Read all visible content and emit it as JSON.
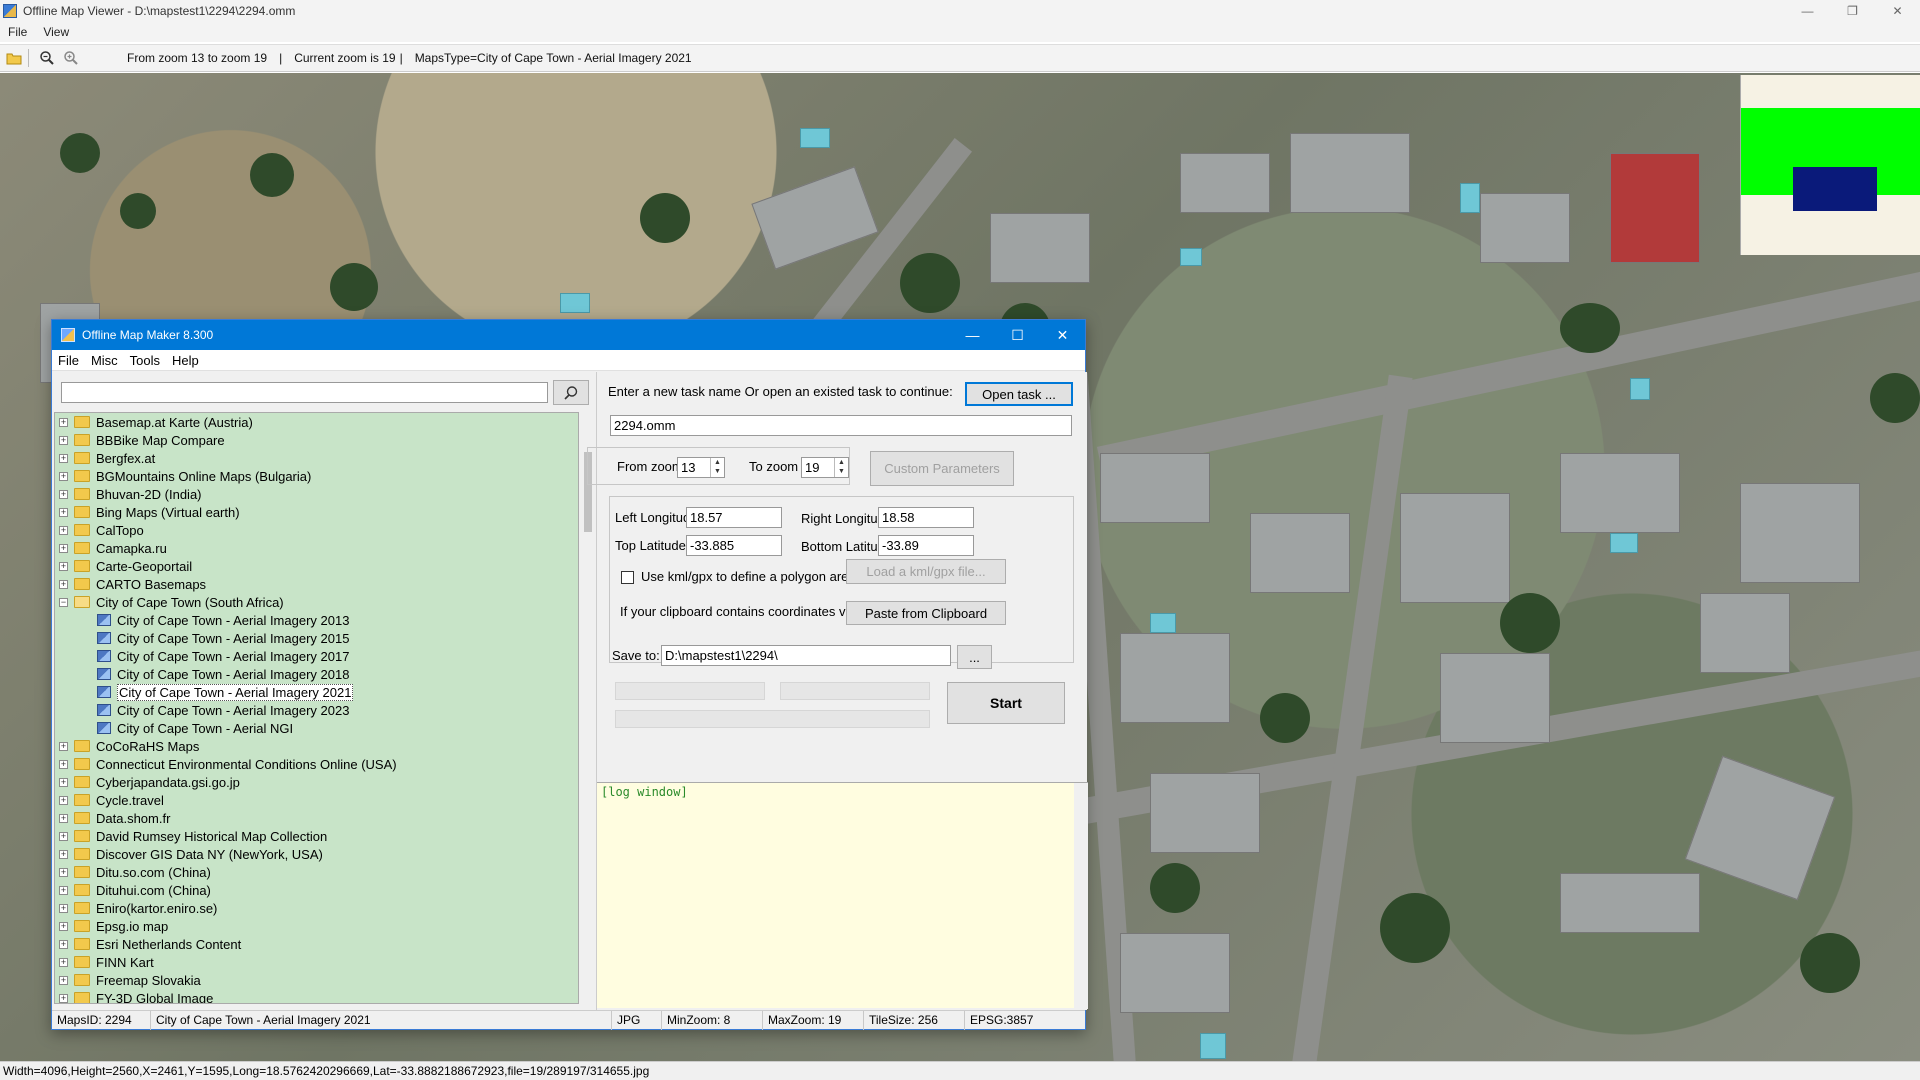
{
  "viewer": {
    "title": "Offline Map Viewer - D:\\mapstest1\\2294\\2294.omm",
    "menu": [
      "File",
      "View"
    ],
    "toolbar": {
      "zoom_range": "From zoom 13 to zoom 19",
      "current_zoom": "Current zoom is 19",
      "maps_type": "MapsType=City of Cape Town - Aerial Imagery 2021",
      "sep": "|"
    },
    "window_controls": {
      "minimize": "—",
      "restore": "❐",
      "close": "✕"
    },
    "statusbar": "Width=4096,Height=2560,X=2461,Y=1595,Long=18.5762420296669,Lat=-33.8882188672923,file=19/289197/314655.jpg"
  },
  "dialog": {
    "title": "Offline Map Maker 8.300",
    "window_controls": {
      "minimize": "—",
      "maximize": "☐",
      "close": "✕"
    },
    "menu": [
      "File",
      "Misc",
      "Tools",
      "Help"
    ],
    "search": {
      "value": "",
      "placeholder": ""
    },
    "tree": [
      {
        "label": "Basemap.at Karte (Austria)",
        "expanded": false
      },
      {
        "label": "BBBike Map Compare",
        "expanded": false
      },
      {
        "label": "Bergfex.at",
        "expanded": false
      },
      {
        "label": "BGMountains Online Maps (Bulgaria)",
        "expanded": false
      },
      {
        "label": "Bhuvan-2D (India)",
        "expanded": false
      },
      {
        "label": "Bing Maps (Virtual earth)",
        "expanded": false
      },
      {
        "label": "CalTopo",
        "expanded": false
      },
      {
        "label": "Camapka.ru",
        "expanded": false
      },
      {
        "label": "Carte-Geoportail",
        "expanded": false
      },
      {
        "label": "CARTO Basemaps",
        "expanded": false
      },
      {
        "label": "City of Cape Town (South Africa)",
        "expanded": true,
        "children": [
          {
            "label": "City of Cape Town - Aerial Imagery 2013",
            "selected": false
          },
          {
            "label": "City of Cape Town - Aerial Imagery 2015",
            "selected": false
          },
          {
            "label": "City of Cape Town - Aerial Imagery 2017",
            "selected": false
          },
          {
            "label": "City of Cape Town - Aerial Imagery 2018",
            "selected": false
          },
          {
            "label": "City of Cape Town - Aerial Imagery 2021",
            "selected": true
          },
          {
            "label": "City of Cape Town - Aerial Imagery 2023",
            "selected": false
          },
          {
            "label": "City of Cape Town - Aerial NGI",
            "selected": false
          }
        ]
      },
      {
        "label": "CoCoRaHS Maps",
        "expanded": false
      },
      {
        "label": "Connecticut Environmental Conditions Online (USA)",
        "expanded": false
      },
      {
        "label": "Cyberjapandata.gsi.go.jp",
        "expanded": false
      },
      {
        "label": "Cycle.travel",
        "expanded": false
      },
      {
        "label": "Data.shom.fr",
        "expanded": false
      },
      {
        "label": "David Rumsey Historical Map Collection",
        "expanded": false
      },
      {
        "label": "Discover GIS Data NY (NewYork, USA)",
        "expanded": false
      },
      {
        "label": "Ditu.so.com (China)",
        "expanded": false
      },
      {
        "label": "Dituhui.com (China)",
        "expanded": false
      },
      {
        "label": "Eniro(kartor.eniro.se)",
        "expanded": false
      },
      {
        "label": "Epsg.io map",
        "expanded": false
      },
      {
        "label": "Esri Netherlands Content",
        "expanded": false
      },
      {
        "label": "FINN Kart",
        "expanded": false
      },
      {
        "label": "Freemap Slovakia",
        "expanded": false
      },
      {
        "label": "FY-3D Global Image",
        "expanded": false
      }
    ],
    "task": {
      "prompt": "Enter a new task name Or open an existed task to continue:",
      "open_button": "Open task ...",
      "task_name": "2294.omm"
    },
    "zoom": {
      "from_label": "From zoom",
      "from_value": "13",
      "to_label": "To zoom",
      "to_value": "19",
      "custom_button": "Custom Parameters"
    },
    "coords": {
      "left_lon_label": "Left Longitude",
      "left_lon": "18.57",
      "right_lon_label": "Right Longitude",
      "right_lon": "18.58",
      "top_lat_label": "Top Latitude",
      "top_lat": "-33.885",
      "bottom_lat_label": "Bottom Latitude",
      "bottom_lat": "-33.89",
      "kml_checkbox_label": "Use kml/gpx to define a polygon area",
      "kml_checked": false,
      "kml_button": "Load a kml/gpx file...",
      "clipboard_label": "If your clipboard contains coordinates values:",
      "clipboard_button": "Paste from Clipboard"
    },
    "save": {
      "label": "Save to:",
      "path": "D:\\mapstest1\\2294\\",
      "browse_button": "...",
      "start_button": "Start"
    },
    "log": {
      "label": "[log window]"
    },
    "statusbar": {
      "maps_id": "MapsID: 2294",
      "maps_name": "City of Cape Town - Aerial Imagery 2021",
      "format": "JPG",
      "min_zoom": "MinZoom: 8",
      "max_zoom": "MaxZoom: 19",
      "tile_size": "TileSize: 256",
      "epsg": "EPSG:3857"
    }
  },
  "colors": {
    "accent": "#0078d7",
    "tree_bg": "#c8e4c8",
    "log_bg": "#fffde0",
    "minimap_view": "#00ff00",
    "minimap_marker": "#0a1a7a"
  }
}
